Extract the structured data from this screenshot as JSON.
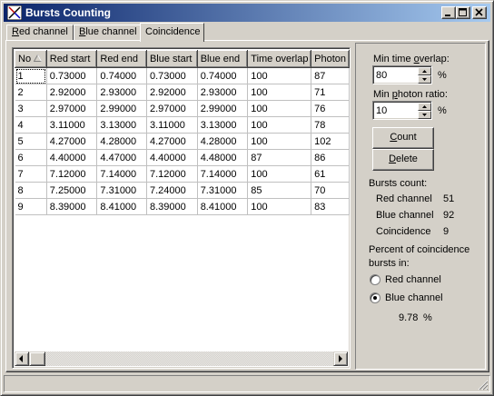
{
  "window": {
    "title": "Bursts Counting",
    "buttons": [
      "minimize",
      "maximize",
      "close"
    ]
  },
  "tabs": [
    {
      "label_u": "R",
      "label_rest": "ed channel",
      "active": false
    },
    {
      "label_u": "B",
      "label_rest": "lue channel",
      "active": false
    },
    {
      "label_u": "",
      "label_rest": "Coincidence",
      "active": true
    }
  ],
  "table": {
    "columns": [
      "No",
      "Red start",
      "Red end",
      "Blue start",
      "Blue end",
      "Time overlap",
      "Photon"
    ],
    "sort_column": "No",
    "rows": [
      [
        "1",
        "0.73000",
        "0.74000",
        "0.73000",
        "0.74000",
        "100",
        "87"
      ],
      [
        "2",
        "2.92000",
        "2.93000",
        "2.92000",
        "2.93000",
        "100",
        "71"
      ],
      [
        "3",
        "2.97000",
        "2.99000",
        "2.97000",
        "2.99000",
        "100",
        "76"
      ],
      [
        "4",
        "3.11000",
        "3.13000",
        "3.11000",
        "3.13000",
        "100",
        "78"
      ],
      [
        "5",
        "4.27000",
        "4.28000",
        "4.27000",
        "4.28000",
        "100",
        "102"
      ],
      [
        "6",
        "4.40000",
        "4.47000",
        "4.40000",
        "4.48000",
        "87",
        "86"
      ],
      [
        "7",
        "7.12000",
        "7.14000",
        "7.12000",
        "7.14000",
        "100",
        "61"
      ],
      [
        "8",
        "7.25000",
        "7.31000",
        "7.24000",
        "7.31000",
        "85",
        "70"
      ],
      [
        "9",
        "8.39000",
        "8.41000",
        "8.39000",
        "8.41000",
        "100",
        "83"
      ]
    ]
  },
  "settings": {
    "min_overlap": {
      "label_pre": "Min time ",
      "label_u": "o",
      "label_post": "verlap:",
      "value": "80",
      "unit": "%"
    },
    "min_ratio": {
      "label_pre": "Min ",
      "label_u": "p",
      "label_post": "hoton ratio:",
      "value": "10",
      "unit": "%"
    }
  },
  "buttons": {
    "count": {
      "label_u": "C",
      "label_rest": "ount"
    },
    "delete": {
      "label_u": "D",
      "label_rest": "elete"
    }
  },
  "stats": {
    "title": "Bursts count:",
    "red_label": "Red channel",
    "red_value": "51",
    "blue_label": "Blue channel",
    "blue_value": "92",
    "coinc_label": "Coincidence",
    "coinc_value": "9"
  },
  "percent": {
    "title_line1": "Percent of coincidence",
    "title_line2": "bursts in:",
    "options": [
      "Red channel",
      "Blue channel"
    ],
    "selected": "Blue channel",
    "value": "9.78",
    "unit": "%"
  },
  "colors": {
    "title_start": "#0a246a",
    "title_end": "#a6caf0",
    "face": "#d4d0c8"
  }
}
